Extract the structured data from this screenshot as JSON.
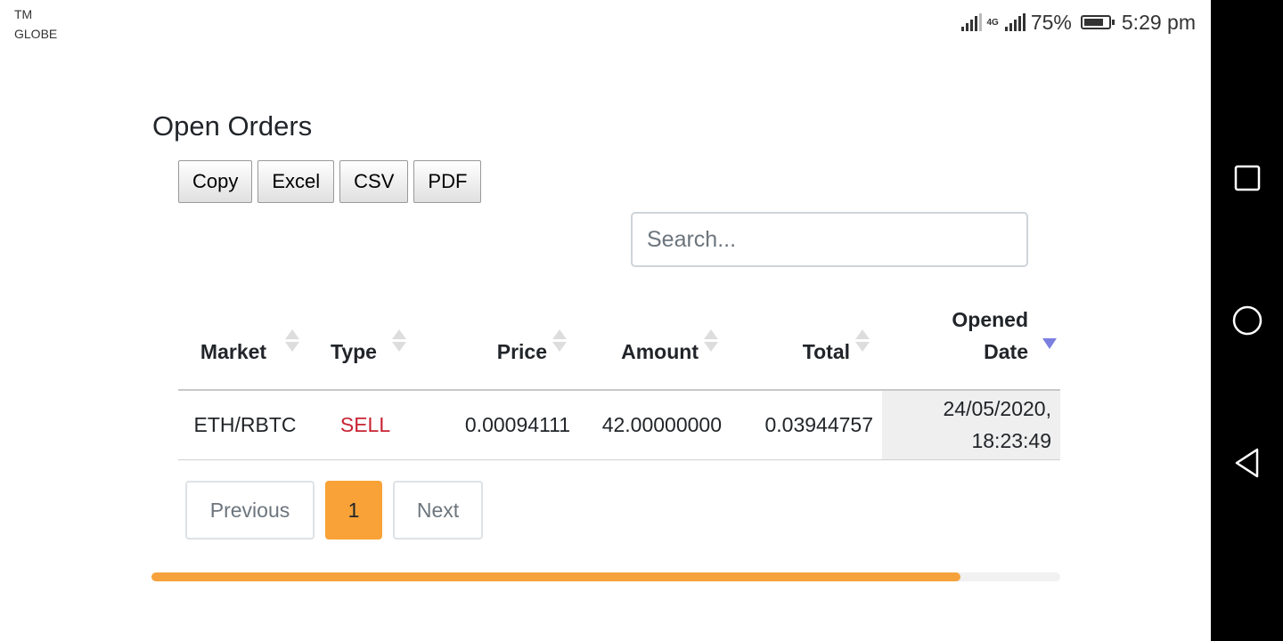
{
  "status_bar": {
    "carrier_line1": "TM",
    "carrier_line2": "GLOBE",
    "network": "4G",
    "battery": "75%",
    "battery_level": 0.75,
    "time": "5:29 pm"
  },
  "page": {
    "title": "Open Orders"
  },
  "export_buttons": {
    "copy": "Copy",
    "excel": "Excel",
    "csv": "CSV",
    "pdf": "PDF"
  },
  "search": {
    "placeholder": "Search...",
    "value": ""
  },
  "table": {
    "headers": {
      "market": "Market",
      "type": "Type",
      "price": "Price",
      "amount": "Amount",
      "total": "Total",
      "opened_date_line1": "Opened",
      "opened_date_line2": "Date"
    },
    "sorted_by": "Opened Date",
    "sort_direction": "descending",
    "rows": [
      {
        "market": "ETH/RBTC",
        "type": "SELL",
        "price": "0.00094111",
        "amount": "42.00000000",
        "total": "0.03944757",
        "date_line1": "24/05/2020,",
        "date_line2": "18:23:49"
      }
    ]
  },
  "pagination": {
    "previous": "Previous",
    "current": "1",
    "next": "Next"
  },
  "scrollbar": {
    "position_fraction": 0.89
  },
  "colors": {
    "accent": "#f9a237",
    "sell": "#c82333",
    "sort_active": "#7b7fe0"
  },
  "nav_icons": [
    "recents-square-icon",
    "home-circle-icon",
    "back-triangle-icon"
  ]
}
